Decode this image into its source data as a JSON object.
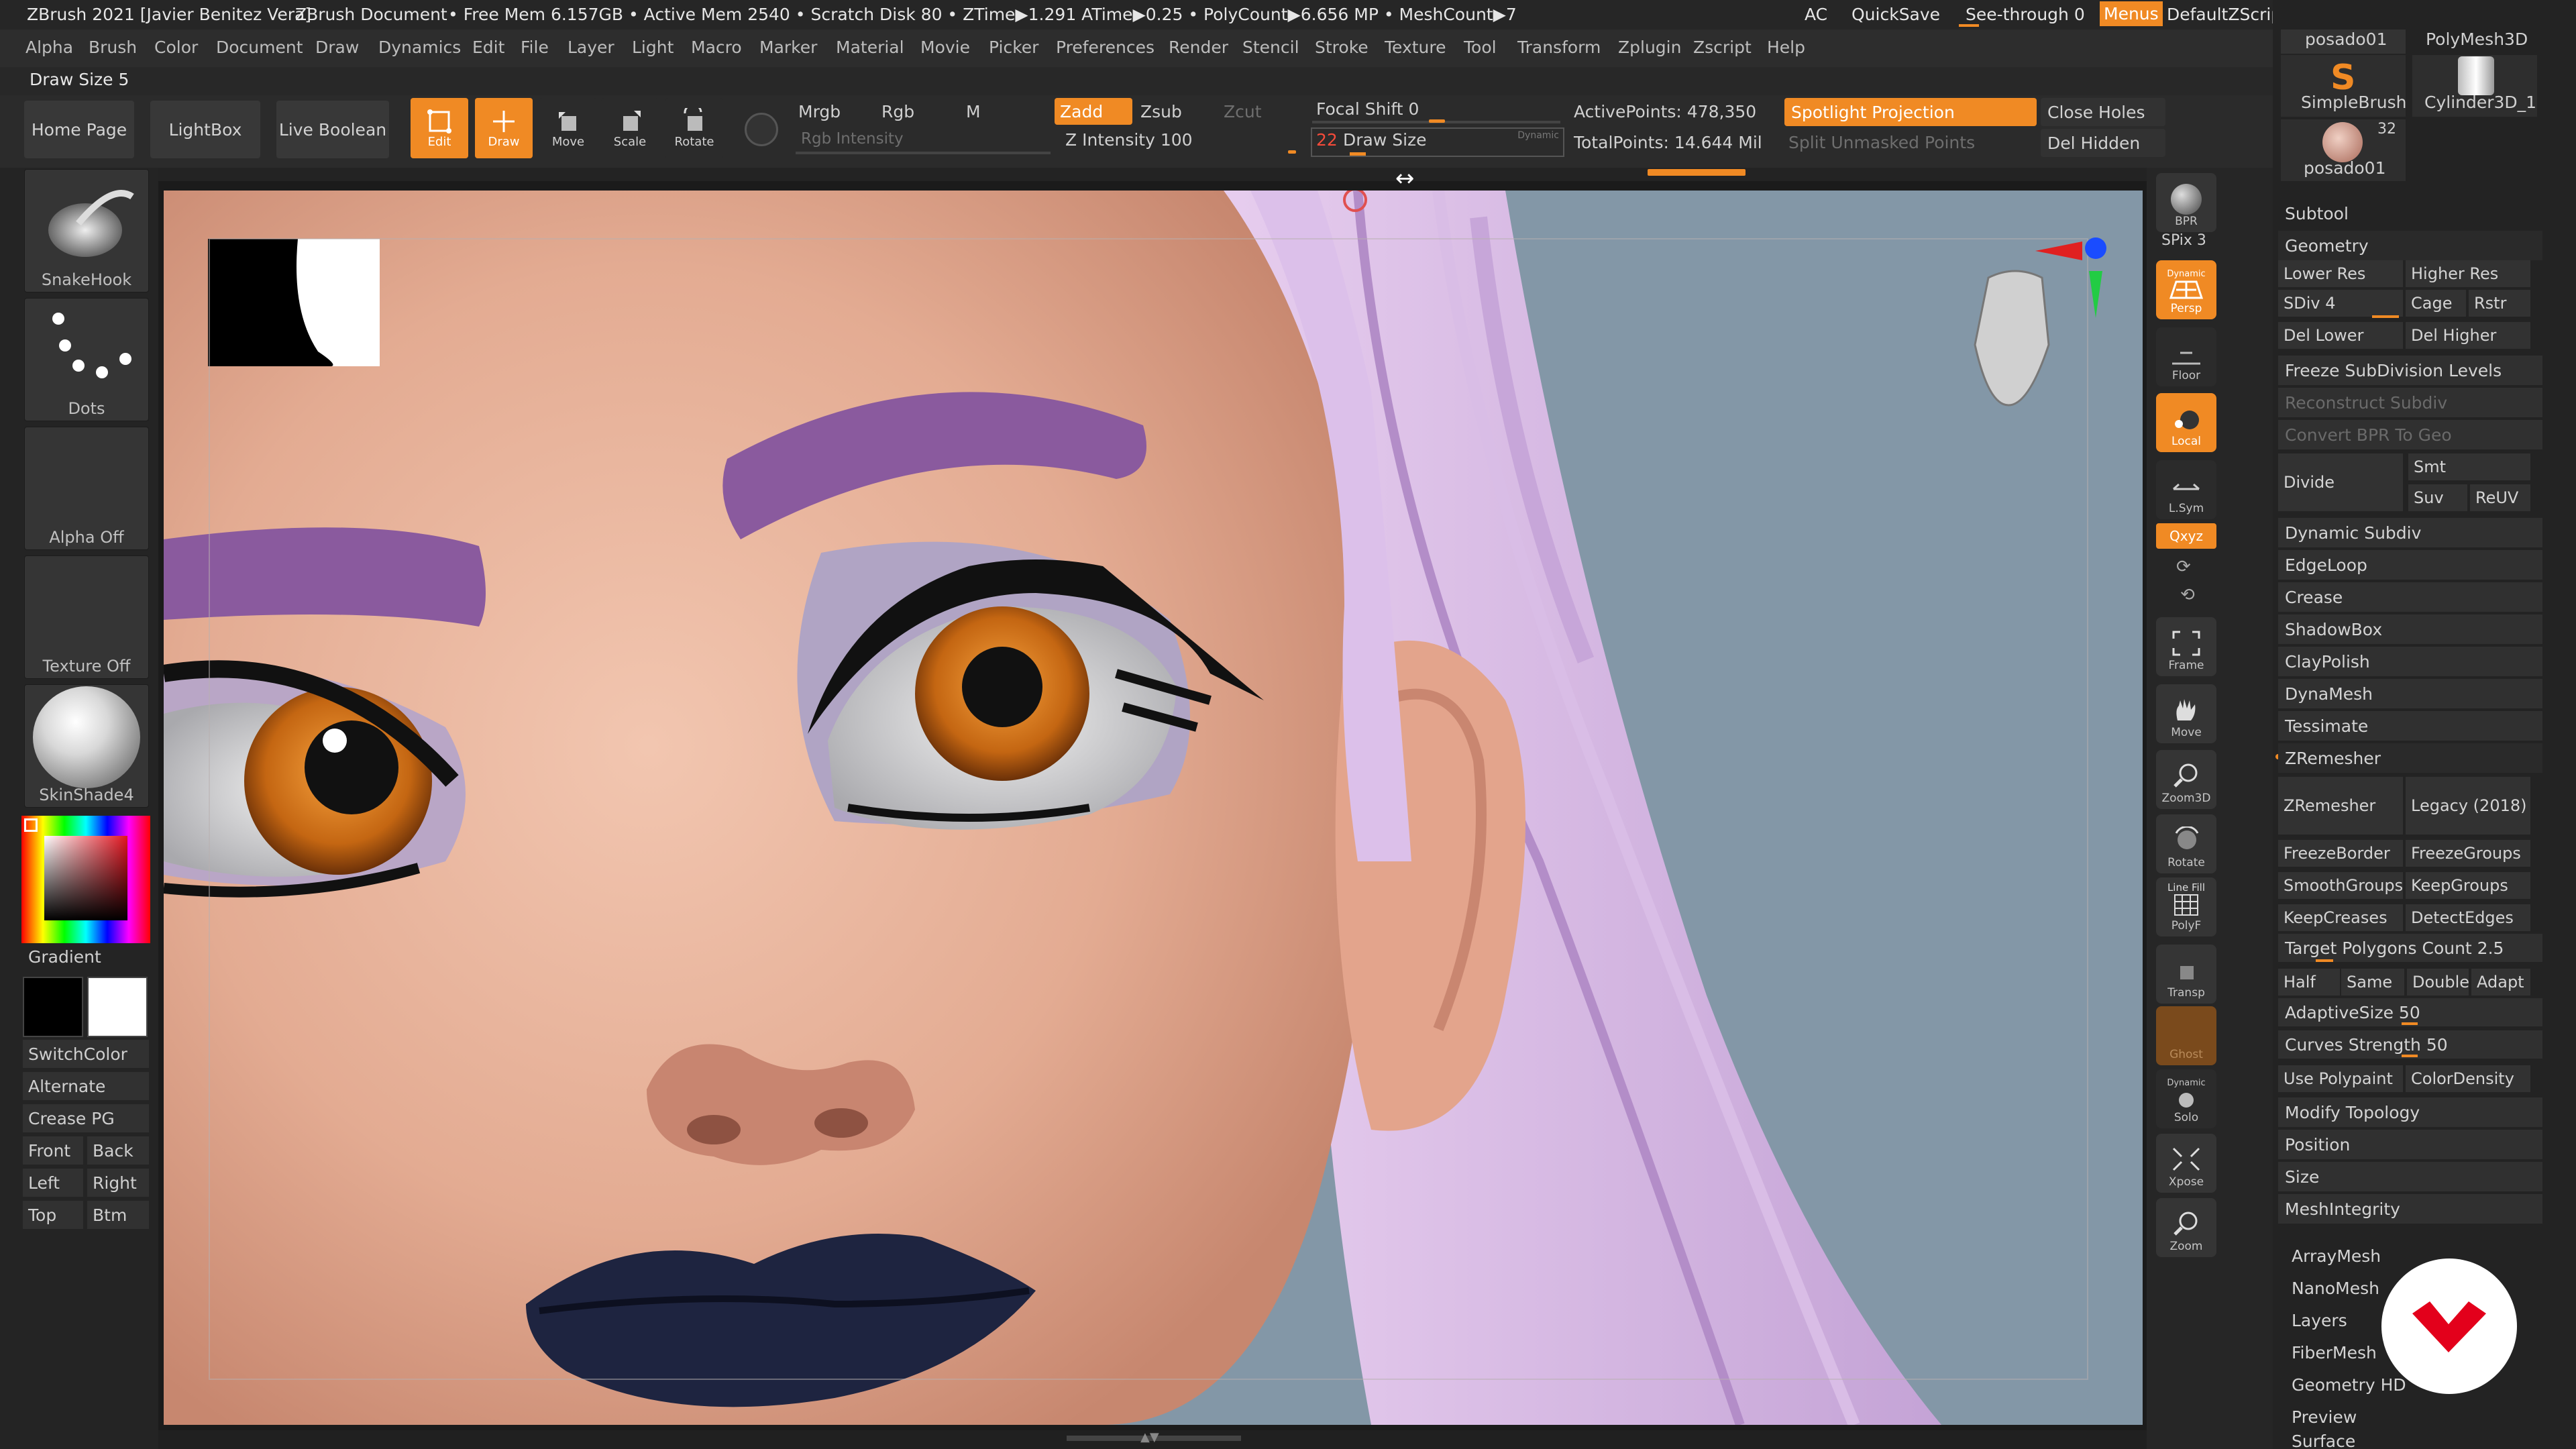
{
  "titlebar": {
    "app": "ZBrush 2021 [Javier Benitez Vera]",
    "doc": "ZBrush Document",
    "stats": "• Free Mem 6.157GB • Active Mem 2540 • Scratch Disk 80 • ZTime▶1.291 ATime▶0.25 • PolyCount▶6.656 MP • MeshCount▶7",
    "ac": "AC",
    "quicksave": "QuickSave",
    "seethrough": "See-through  0",
    "menus": "Menus",
    "script": "DefaultZScript"
  },
  "menu": [
    "Alpha",
    "Brush",
    "Color",
    "Document",
    "Draw",
    "Dynamics",
    "Edit",
    "File",
    "Layer",
    "Light",
    "Macro",
    "Marker",
    "Material",
    "Movie",
    "Picker",
    "Preferences",
    "Render",
    "Stencil",
    "Stroke",
    "Texture",
    "Tool",
    "Transform",
    "Zplugin",
    "Zscript",
    "Help"
  ],
  "drawsize_indicator": "Draw Size 5",
  "toolbar": {
    "home": "Home Page",
    "lightbox": "LightBox",
    "liveboolean": "Live Boolean",
    "edit": "Edit",
    "draw": "Draw",
    "move": "Move",
    "scale": "Scale",
    "rotate": "Rotate",
    "mrgb": "Mrgb",
    "rgb": "Rgb",
    "m": "M",
    "rgb_intensity": "Rgb Intensity",
    "zadd": "Zadd",
    "zsub": "Zsub",
    "zcut": "Zcut",
    "z_intensity": "Z Intensity 100",
    "focal_shift": "Focal Shift 0",
    "draw_size_val": "22",
    "draw_size": "Draw Size",
    "dynamic": "Dynamic",
    "active_points": "ActivePoints: 478,350",
    "total_points": "TotalPoints: 14.644 Mil",
    "spotlight": "Spotlight Projection",
    "split_unmasked": "Split Unmasked Points",
    "close_holes": "Close Holes",
    "del_hidden": "Del Hidden"
  },
  "leftshelf": {
    "brush": "SnakeHook",
    "stroke": "Dots",
    "alpha": "Alpha Off",
    "texture": "Texture Off",
    "material": "SkinShade4",
    "gradient": "Gradient",
    "switchcolor": "SwitchColor",
    "alternate": "Alternate",
    "creasepg": "Crease PG",
    "front": "Front",
    "back": "Back",
    "left": "Left",
    "right": "Right",
    "top": "Top",
    "btm": "Btm",
    "main_color": "#000000",
    "secondary_color": "#ffffff"
  },
  "rightshelf": {
    "bpr": "BPR",
    "spix": "SPix 3",
    "dynamic": "Dynamic",
    "persp": "Persp",
    "floor": "Floor",
    "local": "Local",
    "lsym": "L.Sym",
    "xyz": "Qxyz",
    "frame": "Frame",
    "move": "Move",
    "zoom3d": "Zoom3D",
    "rotate": "Rotate",
    "linefill": "Line Fill",
    "polyf": "PolyF",
    "transp": "Transp",
    "ghost": "Ghost",
    "solo": "Solo",
    "xpose": "Xpose",
    "zoom": "Zoom"
  },
  "tray": {
    "thumbs": [
      "posado01",
      "PolyMesh3D",
      "SimpleBrush",
      "Cylinder3D_1",
      "posado01"
    ],
    "thumb_count": "32",
    "subtool": "Subtool",
    "geometry": "Geometry",
    "lower_res": "Lower Res",
    "higher_res": "Higher Res",
    "sdiv": "SDiv 4",
    "cage": "Cage",
    "rstr": "Rstr",
    "del_lower": "Del Lower",
    "del_higher": "Del Higher",
    "freeze_subdiv": "Freeze SubDivision Levels",
    "reconstruct": "Reconstruct Subdiv",
    "convert_bpr": "Convert BPR To Geo",
    "divide": "Divide",
    "smt": "Smt",
    "suv": "Suv",
    "reuv": "ReUV",
    "items1": [
      "Dynamic Subdiv",
      "EdgeLoop",
      "Crease",
      "ShadowBox",
      "ClayPolish",
      "DynaMesh",
      "Tessimate"
    ],
    "zremesher_hd": "ZRemesher",
    "zremesher": "ZRemesher",
    "legacy": "Legacy (2018)",
    "freezeborder": "FreezeBorder",
    "freezegroups": "FreezeGroups",
    "smoothgroups": "SmoothGroups",
    "keepgroups": "KeepGroups",
    "keepcreases": "KeepCreases",
    "detectedges": "DetectEdges",
    "target": "Target Polygons Count 2.5",
    "half": "Half",
    "same": "Same",
    "double": "Double",
    "adapt": "Adapt",
    "adaptivesize": "AdaptiveSize 50",
    "curves": "Curves Strength 50",
    "usepolypaint": "Use Polypaint",
    "colordensity": "ColorDensity",
    "items2": [
      "Modify Topology",
      "Position",
      "Size",
      "MeshIntegrity"
    ],
    "items3": [
      "ArrayMesh",
      "NanoMesh",
      "Layers",
      "FiberMesh",
      "Geometry HD",
      "Preview",
      "Surface"
    ]
  },
  "colors": {
    "accent": "#f08a24",
    "canvas_bg": "#8397a7",
    "panel": "#2b2b2b"
  }
}
